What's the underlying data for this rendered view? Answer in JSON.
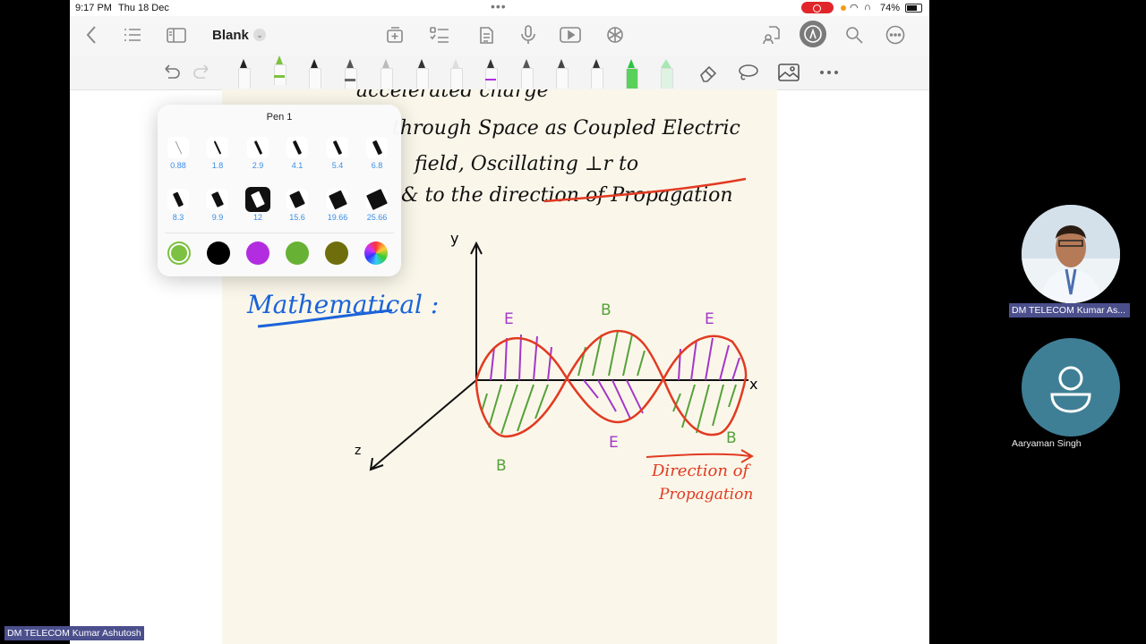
{
  "status_bar": {
    "time": "9:17 PM",
    "date": "Thu 18 Dec",
    "battery": "74%"
  },
  "toolbar": {
    "document_title": "Blank"
  },
  "pen_picker": {
    "title": "Pen 1",
    "widths": [
      "0.88",
      "1.8",
      "2.9",
      "4.1",
      "5.4",
      "6.8",
      "8.3",
      "9.9",
      "12",
      "15.6",
      "19.66",
      "25.66"
    ],
    "selected_width": "12",
    "colors": [
      "#7cc142",
      "#000000",
      "#b22de0",
      "#67b234",
      "#6f6e0c",
      "spectrum"
    ],
    "selected_color": "#7cc142"
  },
  "canvas": {
    "line1": "accelerated charge",
    "line2": "through Space as Coupled Electric",
    "line3": "field, Oscillating ⊥r to",
    "line4": "& to the direction of Propagation",
    "heading": "Mathematical :",
    "axis_y": "y",
    "axis_x": "x",
    "axis_z": "z",
    "wave_labels_top": [
      "E",
      "B",
      "E"
    ],
    "wave_labels_bottom": [
      "B",
      "E",
      "B"
    ],
    "note1": "Direction of",
    "note2": "Propagation"
  },
  "participants": [
    {
      "name": "DM TELECOM Kumar As...",
      "has_video": true
    },
    {
      "name": "Aaryaman Singh",
      "has_video": false
    }
  ],
  "presenter_label": "DM TELECOM Kumar Ashutosh",
  "colors": {
    "ink_blue": "#1b63d8",
    "ink_red": "#e23a22",
    "ink_green": "#57a13a",
    "ink_purple": "#a536c9",
    "paper": "#faf7ea"
  }
}
